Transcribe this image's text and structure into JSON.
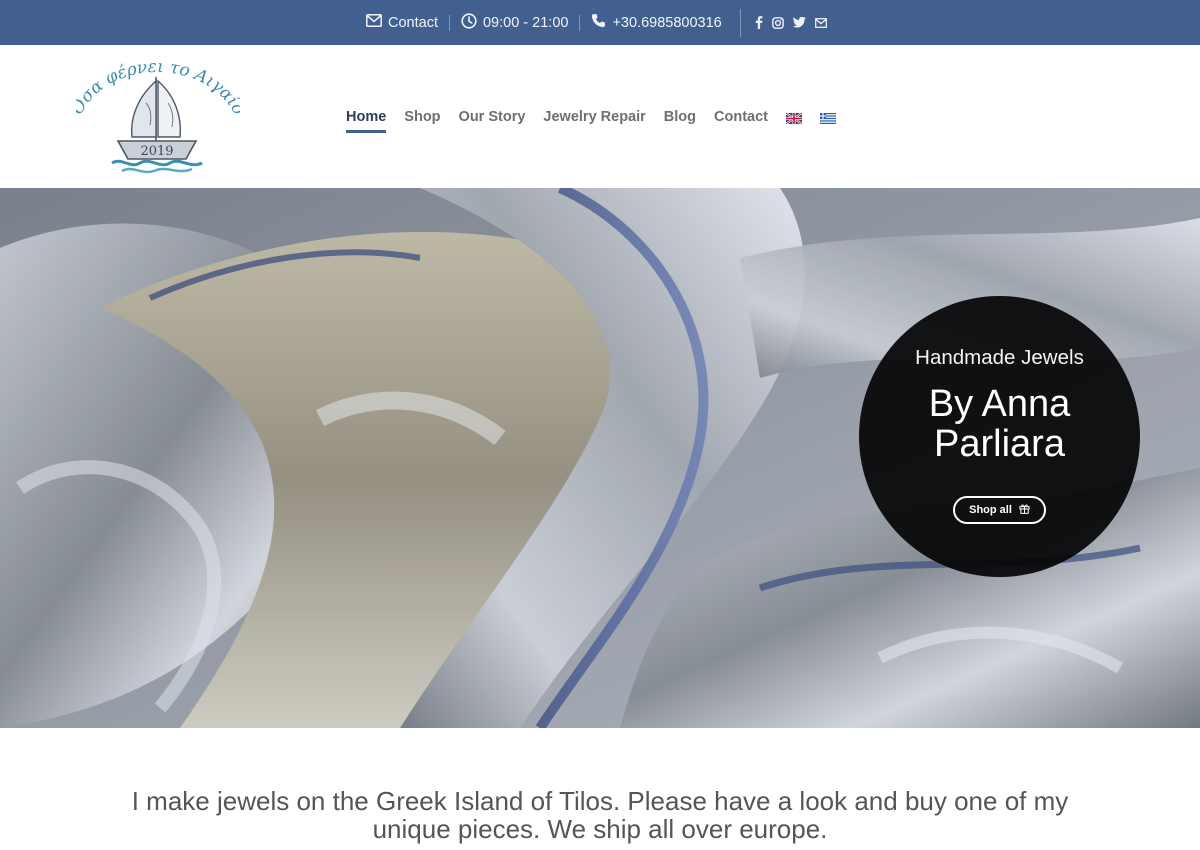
{
  "topbar": {
    "contact_label": "Contact",
    "hours": "09:00 - 21:00",
    "phone": "+30.6985800316",
    "social_icons": [
      "facebook-icon",
      "instagram-icon",
      "twitter-icon",
      "envelope-icon"
    ]
  },
  "nav": {
    "items": [
      {
        "label": "Home",
        "active": true
      },
      {
        "label": "Shop",
        "active": false
      },
      {
        "label": "Our Story",
        "active": false
      },
      {
        "label": "Jewelry Repair",
        "active": false
      },
      {
        "label": "Blog",
        "active": false
      },
      {
        "label": "Contact",
        "active": false
      }
    ],
    "languages": [
      "english-flag",
      "greek-flag"
    ]
  },
  "logo": {
    "text": "Όσα φέρνει το Αιγαίο",
    "year": "2019"
  },
  "hero": {
    "subtitle": "Handmade Jewels",
    "title": "By Anna Parliara",
    "button_label": "Shop all",
    "button_icon": "gift-icon"
  },
  "intro": {
    "text": "I make jewels on the Greek Island of Tilos. Please have a look and buy one of my unique pieces. We ship all over europe."
  },
  "colors": {
    "topbar": "#42608f",
    "nav_active": "#2f3d55",
    "nav_text": "#6f6f6f",
    "hero_circle": "#050506",
    "intro_text": "#555555"
  }
}
